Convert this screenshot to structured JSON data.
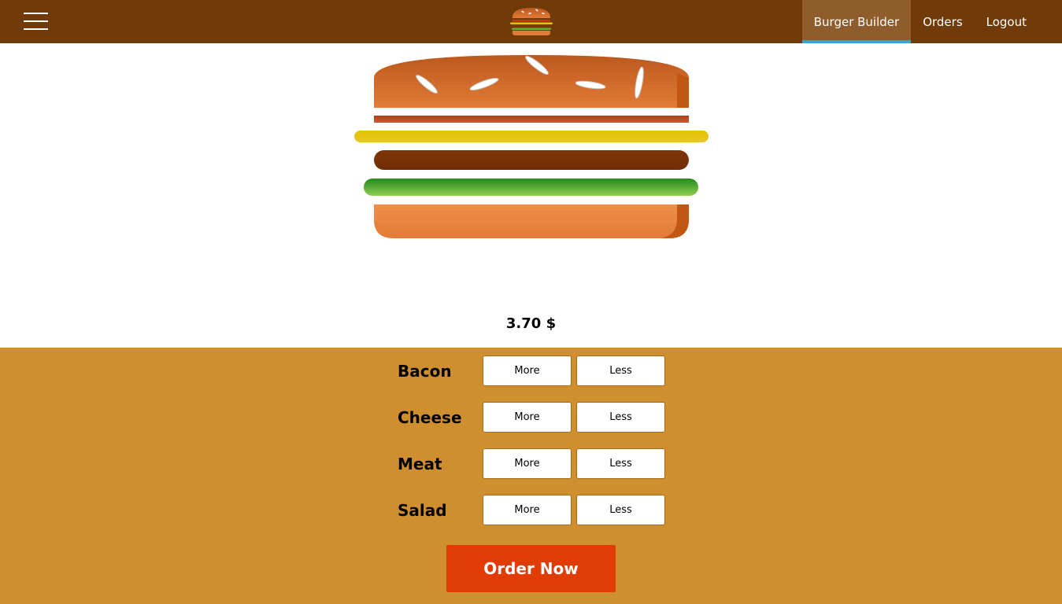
{
  "toolbar": {
    "menu_icon": "hamburger-menu-icon",
    "logo_icon": "burger-logo-icon",
    "nav": [
      {
        "label": "Burger Builder",
        "active": true
      },
      {
        "label": "Orders",
        "active": false
      },
      {
        "label": "Logout",
        "active": false
      }
    ]
  },
  "burger": {
    "ingredients": [
      "bacon",
      "cheese",
      "meat",
      "salad"
    ]
  },
  "price": "3.70 $",
  "controls": [
    {
      "label": "Bacon",
      "more": "More",
      "less": "Less"
    },
    {
      "label": "Cheese",
      "more": "More",
      "less": "Less"
    },
    {
      "label": "Meat",
      "more": "More",
      "less": "Less"
    },
    {
      "label": "Salad",
      "more": "More",
      "less": "Less"
    }
  ],
  "order_button": "Order Now",
  "colors": {
    "toolbar": "#703B09",
    "nav_active": "#8F5C2C",
    "nav_active_border": "#40A4C8",
    "controls_bg": "#CF8F2E",
    "order_button": "#E23C06",
    "bun": "#E27B36",
    "bacon": "#BF3813",
    "cheese": "#E3C200",
    "meat": "#7F3608",
    "salad": "#58B82A"
  }
}
